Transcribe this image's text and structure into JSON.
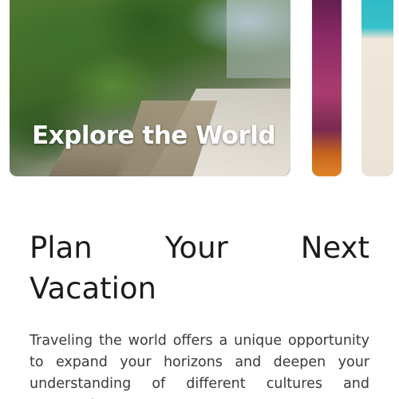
{
  "carousel": {
    "cards": [
      {
        "title": "Explore the World"
      }
    ]
  },
  "article": {
    "headline": "Plan Your Next Vacation",
    "body": "Traveling the world offers a unique opportunity to expand your horizons and deepen your understanding of different cultures and perspectives."
  }
}
